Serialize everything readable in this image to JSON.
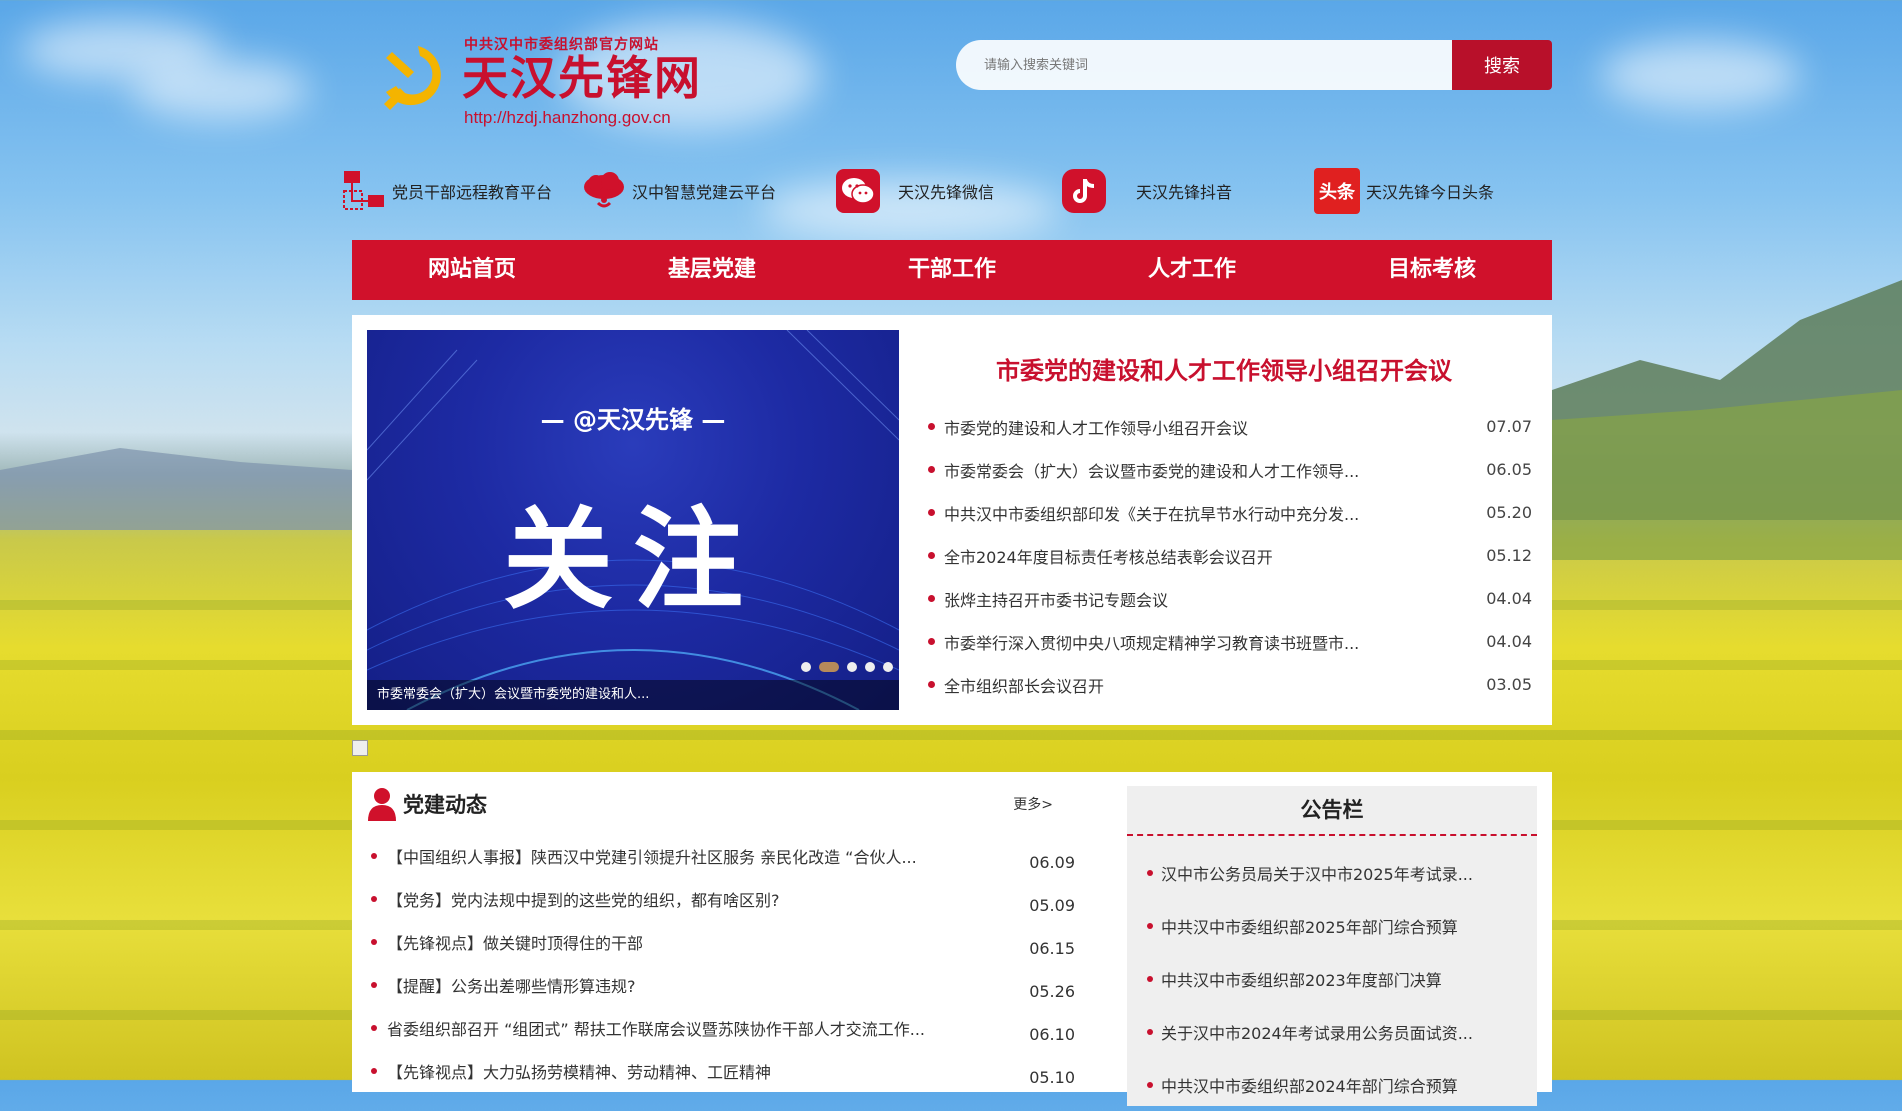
{
  "header": {
    "logo_sub": "中共汉中市委组织部官方网站",
    "logo_title": "天汉先锋网",
    "logo_url": "http://hzdj.hanzhong.gov.cn"
  },
  "search": {
    "placeholder": "请输入搜索关键词",
    "button_label": "搜索"
  },
  "quick_links": [
    {
      "label": "党员干部远程教育平台",
      "icon": "network-icon"
    },
    {
      "label": "汉中智慧党建云平台",
      "icon": "cloud-icon"
    },
    {
      "label": "天汉先锋微信",
      "icon": "wechat-icon"
    },
    {
      "label": "天汉先锋抖音",
      "icon": "douyin-icon"
    },
    {
      "label": "天汉先锋今日头条",
      "icon": "toutiao-icon",
      "badge": "头条"
    }
  ],
  "nav": [
    "网站首页",
    "基层党建",
    "干部工作",
    "人才工作",
    "目标考核"
  ],
  "slider": {
    "tag": "— @天汉先锋 —",
    "big_text": "关注",
    "caption": "市委常委会（扩大）会议暨市委党的建设和人...",
    "dots": 5,
    "active_dot": 2
  },
  "feature": {
    "headline": "市委党的建设和人才工作领导小组召开会议",
    "items": [
      {
        "title": "市委党的建设和人才工作领导小组召开会议",
        "date": "07.07"
      },
      {
        "title": "市委常委会（扩大）会议暨市委党的建设和人才工作领导...",
        "date": "06.05"
      },
      {
        "title": "中共汉中市委组织部印发《关于在抗旱节水行动中充分发...",
        "date": "05.20"
      },
      {
        "title": "全市2024年度目标责任考核总结表彰会议召开",
        "date": "05.12"
      },
      {
        "title": "张烨主持召开市委书记专题会议",
        "date": "04.04"
      },
      {
        "title": "市委举行深入贯彻中央八项规定精神学习教育读书班暨市...",
        "date": "04.04"
      },
      {
        "title": "全市组织部长会议召开",
        "date": "03.05"
      }
    ]
  },
  "news": {
    "title": "党建动态",
    "more": "更多>",
    "items": [
      {
        "title": "【中国组织人事报】陕西汉中党建引领提升社区服务 亲民化改造 “合伙人...",
        "date": "06.09"
      },
      {
        "title": "【党务】党内法规中提到的这些党的组织，都有啥区别?",
        "date": "05.09"
      },
      {
        "title": "【先锋视点】做关键时顶得住的干部",
        "date": "06.15"
      },
      {
        "title": "【提醒】公务出差哪些情形算违规?",
        "date": "05.26"
      },
      {
        "title": "省委组织部召开 “组团式” 帮扶工作联席会议暨苏陕协作干部人才交流工作...",
        "date": "06.10"
      },
      {
        "title": "【先锋视点】大力弘扬劳模精神、劳动精神、工匠精神",
        "date": "05.10"
      }
    ]
  },
  "notice": {
    "title": "公告栏",
    "items": [
      "汉中市公务员局关于汉中市2025年考试录...",
      "中共汉中市委组织部2025年部门综合预算",
      "中共汉中市委组织部2023年度部门决算",
      "关于汉中市2024年考试录用公务员面试资...",
      "中共汉中市委组织部2024年部门综合预算"
    ]
  },
  "colors": {
    "brand_red": "#d0112b",
    "accent_red": "#c8102e",
    "search_btn": "#b8102a"
  }
}
